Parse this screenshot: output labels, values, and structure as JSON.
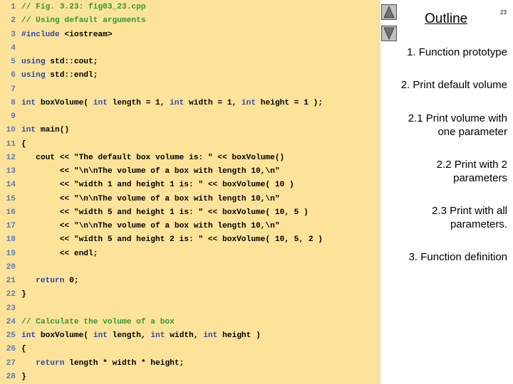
{
  "code": {
    "lines": [
      {
        "num": "1",
        "segments": [
          {
            "t": "// Fig. 3.23: fig03_23.cpp",
            "c": "cm"
          }
        ]
      },
      {
        "num": "2",
        "segments": [
          {
            "t": "// Using default arguments",
            "c": "cm"
          }
        ]
      },
      {
        "num": "3",
        "segments": [
          {
            "t": "#include",
            "c": "kw"
          },
          {
            "t": " <iostream>",
            "c": "tx"
          }
        ]
      },
      {
        "num": "4",
        "segments": []
      },
      {
        "num": "5",
        "segments": [
          {
            "t": "using",
            "c": "kw"
          },
          {
            "t": " std::cout;",
            "c": "tx"
          }
        ]
      },
      {
        "num": "6",
        "segments": [
          {
            "t": "using",
            "c": "kw"
          },
          {
            "t": " std::endl;",
            "c": "tx"
          }
        ]
      },
      {
        "num": "7",
        "segments": []
      },
      {
        "num": "8",
        "segments": [
          {
            "t": "int",
            "c": "kw"
          },
          {
            "t": " boxVolume( ",
            "c": "tx"
          },
          {
            "t": "int",
            "c": "kw"
          },
          {
            "t": " length = 1, ",
            "c": "tx"
          },
          {
            "t": "int",
            "c": "kw"
          },
          {
            "t": " width = 1, ",
            "c": "tx"
          },
          {
            "t": "int",
            "c": "kw"
          },
          {
            "t": " height = 1 );",
            "c": "tx"
          }
        ]
      },
      {
        "num": "9",
        "segments": []
      },
      {
        "num": "10",
        "segments": [
          {
            "t": "int",
            "c": "kw"
          },
          {
            "t": " main()",
            "c": "tx"
          }
        ]
      },
      {
        "num": "11",
        "segments": [
          {
            "t": "{",
            "c": "tx"
          }
        ]
      },
      {
        "num": "12",
        "segments": [
          {
            "t": "   cout << \"The default box volume is: \" << boxVolume()",
            "c": "tx"
          }
        ]
      },
      {
        "num": "13",
        "segments": [
          {
            "t": "        << \"\\n\\nThe volume of a box with length 10,\\n\"",
            "c": "tx"
          }
        ]
      },
      {
        "num": "14",
        "segments": [
          {
            "t": "        << \"width 1 and height 1 is: \" << boxVolume( 10 )",
            "c": "tx"
          }
        ]
      },
      {
        "num": "15",
        "segments": [
          {
            "t": "        << \"\\n\\nThe volume of a box with length 10,\\n\"",
            "c": "tx"
          }
        ]
      },
      {
        "num": "16",
        "segments": [
          {
            "t": "        << \"width 5 and height 1 is: \" << boxVolume( 10, 5 )",
            "c": "tx"
          }
        ]
      },
      {
        "num": "17",
        "segments": [
          {
            "t": "        << \"\\n\\nThe volume of a box with length 10,\\n\"",
            "c": "tx"
          }
        ]
      },
      {
        "num": "18",
        "segments": [
          {
            "t": "        << \"width 5 and height 2 is: \" << boxVolume( 10, 5, 2 )",
            "c": "tx"
          }
        ]
      },
      {
        "num": "19",
        "segments": [
          {
            "t": "        << endl;",
            "c": "tx"
          }
        ]
      },
      {
        "num": "20",
        "segments": []
      },
      {
        "num": "21",
        "segments": [
          {
            "t": "   ",
            "c": "tx"
          },
          {
            "t": "return",
            "c": "kw"
          },
          {
            "t": " 0;",
            "c": "tx"
          }
        ]
      },
      {
        "num": "22",
        "segments": [
          {
            "t": "}",
            "c": "tx"
          }
        ]
      },
      {
        "num": "23",
        "segments": []
      },
      {
        "num": "24",
        "segments": [
          {
            "t": "// Calculate the volume of a box",
            "c": "cm"
          }
        ]
      },
      {
        "num": "25",
        "segments": [
          {
            "t": "int",
            "c": "kw"
          },
          {
            "t": " boxVolume( ",
            "c": "tx"
          },
          {
            "t": "int",
            "c": "kw"
          },
          {
            "t": " length, ",
            "c": "tx"
          },
          {
            "t": "int",
            "c": "kw"
          },
          {
            "t": " width, ",
            "c": "tx"
          },
          {
            "t": "int",
            "c": "kw"
          },
          {
            "t": " height )",
            "c": "tx"
          }
        ]
      },
      {
        "num": "26",
        "segments": [
          {
            "t": "{",
            "c": "tx"
          }
        ]
      },
      {
        "num": "27",
        "segments": [
          {
            "t": "   ",
            "c": "tx"
          },
          {
            "t": "return",
            "c": "kw"
          },
          {
            "t": " length * width * height;",
            "c": "tx"
          }
        ]
      },
      {
        "num": "28",
        "segments": [
          {
            "t": "}",
            "c": "tx"
          }
        ]
      }
    ]
  },
  "sidebar": {
    "title": "Outline",
    "slide_number": "23",
    "nav": {
      "up_icon": "triangle-up-icon",
      "down_icon": "triangle-down-icon"
    },
    "items": [
      {
        "lines": [
          "1.  Function prototype"
        ]
      },
      {
        "lines": [
          "2.  Print default volume"
        ]
      },
      {
        "lines": [
          "2.1  Print volume with ",
          "one parameter"
        ]
      },
      {
        "lines": [
          "2.2  Print with 2 ",
          "parameters"
        ]
      },
      {
        "lines": [
          "2.3  Print with all ",
          "parameters."
        ]
      },
      {
        "lines": [
          "3.  Function definition"
        ]
      }
    ]
  },
  "colors": {
    "code_background": "#fde39a",
    "keyword": "#2b47a8",
    "comment": "#2f9a2f",
    "line_number": "#5a7ab8"
  }
}
